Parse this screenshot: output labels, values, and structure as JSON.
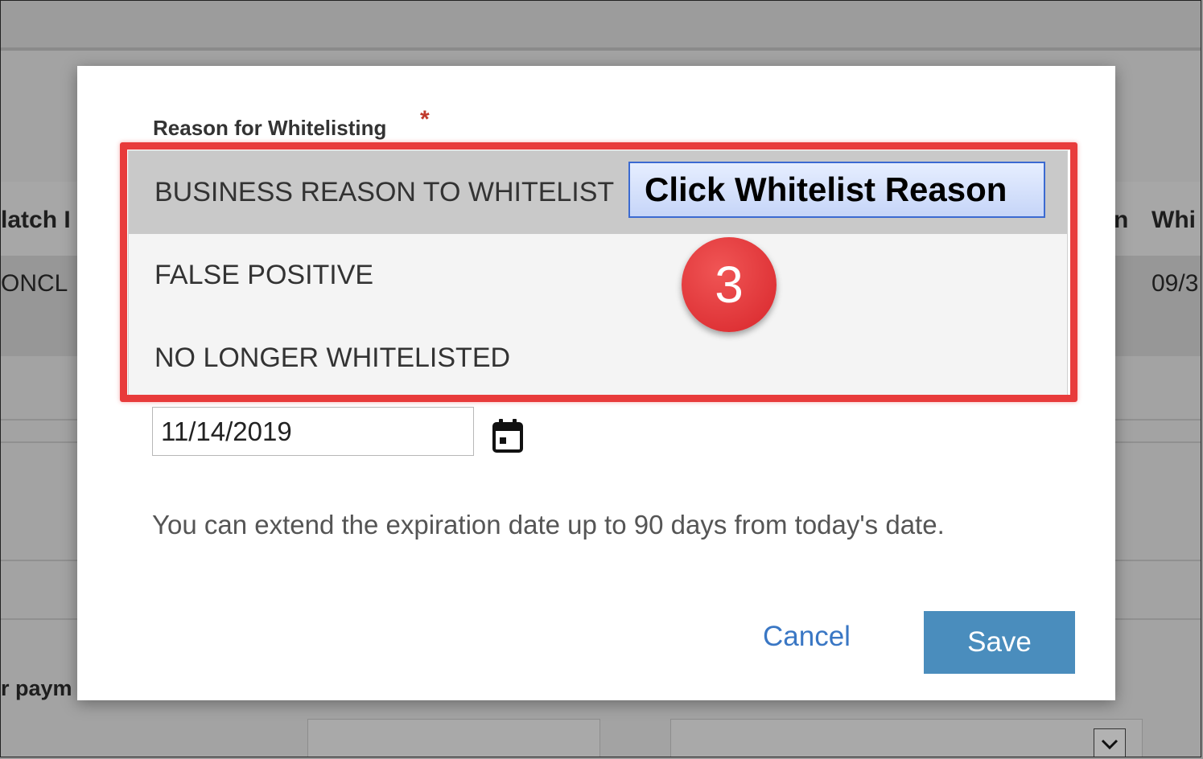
{
  "background": {
    "col_header_left": "latch I",
    "col_header_right_fragment": "n",
    "col_header_right": "Whi",
    "row_value_left": "ONCL",
    "row_value_right": "09/3",
    "lower_label": "r paym"
  },
  "modal": {
    "reason_label": "Reason for Whitelisting",
    "required_marker": "*",
    "dropdown_options": [
      "BUSINESS REASON TO WHITELIST",
      "FALSE POSITIVE",
      "NO LONGER WHITELISTED"
    ],
    "date_value": "11/14/2019",
    "help_text": "You can extend the expiration date up to 90 days from today's date.",
    "cancel_label": "Cancel",
    "save_label": "Save"
  },
  "annotation": {
    "callout_text": "Click Whitelist Reason",
    "step_number": "3",
    "highlight_color": "#e83b3b"
  },
  "colors": {
    "save_button": "#4a8dbd",
    "cancel_link": "#3a77c4",
    "selected_option": "#c9c9c9"
  }
}
